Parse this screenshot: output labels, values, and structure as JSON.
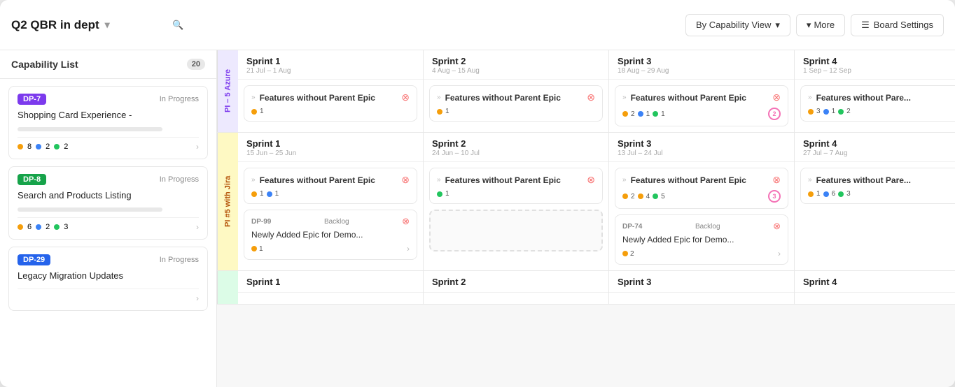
{
  "app": {
    "title": "Q2 QBR in dept",
    "search_placeholder": "Search...",
    "view_label": "By Capability View",
    "more_label": "More",
    "board_settings_label": "Board Settings"
  },
  "sidebar": {
    "title": "Capability List",
    "count": "20",
    "cards": [
      {
        "id": "DP-7",
        "badge_class": "badge-purple",
        "status": "In Progress",
        "title": "Shopping Card Experience -",
        "dots": [
          {
            "color": "dot-orange",
            "count": "8"
          },
          {
            "color": "dot-blue",
            "count": "2"
          },
          {
            "color": "dot-green",
            "count": "2"
          }
        ]
      },
      {
        "id": "DP-8",
        "badge_class": "badge-green",
        "status": "In Progress",
        "title": "Search and Products Listing",
        "dots": [
          {
            "color": "dot-orange",
            "count": "6"
          },
          {
            "color": "dot-blue",
            "count": "2"
          },
          {
            "color": "dot-green",
            "count": "3"
          }
        ]
      },
      {
        "id": "DP-29",
        "badge_class": "badge-blue",
        "status": "In Progress",
        "title": "Legacy Migration Updates",
        "dots": []
      }
    ]
  },
  "pi_rows": [
    {
      "label": "PI – 5 Azure",
      "label_class": "pi-azure",
      "sprints": [
        {
          "name": "Sprint 1",
          "dates": "21 Jul – 1 Aug",
          "feature": {
            "title": "Features without Parent Epic",
            "dots": [
              {
                "color": "dot-orange",
                "count": "1"
              }
            ]
          },
          "epics": []
        },
        {
          "name": "Sprint 2",
          "dates": "4 Aug – 15 Aug",
          "feature": {
            "title": "Features without Parent Epic",
            "dots": [
              {
                "color": "dot-orange",
                "count": "1"
              }
            ]
          },
          "epics": []
        },
        {
          "name": "Sprint 3",
          "dates": "18 Aug – 29 Aug",
          "feature": {
            "title": "Features without Parent Epic",
            "dots": [
              {
                "color": "dot-orange",
                "count": "2"
              },
              {
                "color": "dot-blue",
                "count": "1"
              },
              {
                "color": "dot-green",
                "count": "1"
              }
            ],
            "badge_num": "2"
          },
          "epics": []
        },
        {
          "name": "Sprint 4",
          "dates": "1 Sep – 12 Sep",
          "feature": {
            "title": "Features without Pare...",
            "dots": [
              {
                "color": "dot-orange",
                "count": "3"
              },
              {
                "color": "dot-blue",
                "count": "1"
              },
              {
                "color": "dot-green",
                "count": "2"
              }
            ]
          },
          "epics": []
        }
      ]
    },
    {
      "label": "PI #5 with Jira",
      "label_class": "pi-jira",
      "sprints": [
        {
          "name": "Sprint 1",
          "dates": "15 Jun – 25 Jun",
          "feature": {
            "title": "Features without Parent Epic",
            "dots": [
              {
                "color": "dot-orange",
                "count": "1"
              },
              {
                "color": "dot-blue",
                "count": "1"
              }
            ]
          },
          "epics": [
            {
              "id": "DP-99",
              "status": "Backlog",
              "title": "Newly Added Epic for Demo...",
              "dots": [
                {
                  "color": "dot-orange",
                  "count": "1"
                }
              ]
            }
          ]
        },
        {
          "name": "Sprint 2",
          "dates": "24 Jun – 10 Jul",
          "feature": {
            "title": "Features without Parent Epic",
            "dots": [
              {
                "color": "dot-green",
                "count": "1"
              }
            ]
          },
          "epics": [],
          "drop_zone": true
        },
        {
          "name": "Sprint 3",
          "dates": "13 Jul – 24 Jul",
          "feature": {
            "title": "Features without Parent Epic",
            "dots": [
              {
                "color": "dot-orange",
                "count": "2"
              },
              {
                "color": "dot-orange",
                "count": "4"
              },
              {
                "color": "dot-green",
                "count": "5"
              }
            ],
            "badge_num": "3"
          },
          "epics": [
            {
              "id": "DP-74",
              "status": "Backlog",
              "title": "Newly Added Epic for Demo...",
              "dots": [
                {
                  "color": "dot-orange",
                  "count": "2"
                }
              ]
            }
          ]
        },
        {
          "name": "Sprint 4",
          "dates": "27 Jul – 7 Aug",
          "feature": {
            "title": "Features without Pare...",
            "dots": [
              {
                "color": "dot-orange",
                "count": "1"
              },
              {
                "color": "dot-blue",
                "count": "6"
              },
              {
                "color": "dot-green",
                "count": "3"
              }
            ]
          },
          "epics": []
        }
      ]
    },
    {
      "label": "",
      "label_class": "pi-green",
      "sprints": [
        {
          "name": "Sprint 1",
          "dates": "",
          "feature": null,
          "epics": []
        },
        {
          "name": "Sprint 2",
          "dates": "",
          "feature": null,
          "epics": []
        },
        {
          "name": "Sprint 3",
          "dates": "",
          "feature": null,
          "epics": []
        },
        {
          "name": "Sprint 4",
          "dates": "",
          "feature": null,
          "epics": []
        }
      ]
    }
  ]
}
